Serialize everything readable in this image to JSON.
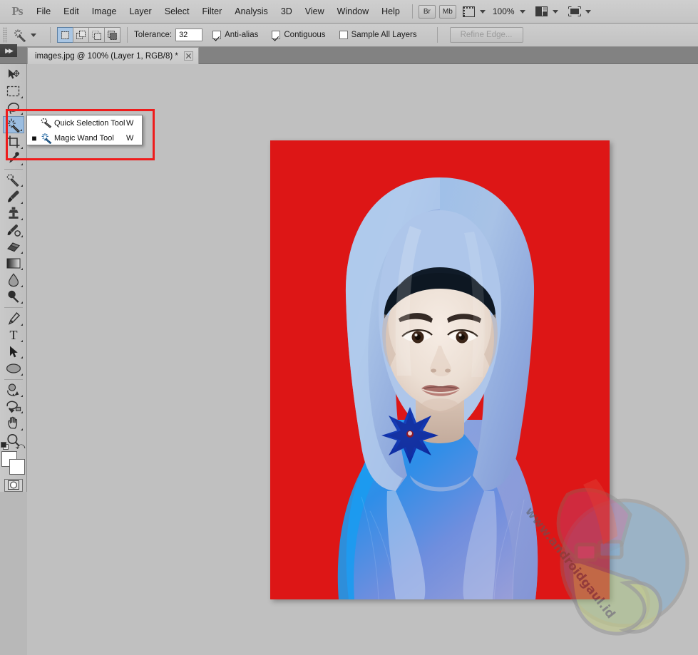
{
  "app": {
    "name": "Adobe Photoshop CS5",
    "logo_text": "Ps"
  },
  "menubar": {
    "items": [
      {
        "label": "File"
      },
      {
        "label": "Edit"
      },
      {
        "label": "Image"
      },
      {
        "label": "Layer"
      },
      {
        "label": "Select"
      },
      {
        "label": "Filter"
      },
      {
        "label": "Analysis"
      },
      {
        "label": "3D"
      },
      {
        "label": "View"
      },
      {
        "label": "Window"
      },
      {
        "label": "Help"
      }
    ],
    "bridge_label": "Br",
    "minibridge_label": "Mb",
    "zoom_level": "100%",
    "view_extras_icon": "view-extras-icon",
    "arrange_documents_icon": "arrange-documents-icon",
    "screen_mode_icon": "screen-mode-icon"
  },
  "optionsbar": {
    "tool_icon": "magic-wand-icon",
    "tool_preset_caret": "chevron-down-icon",
    "selection_modes": [
      {
        "name": "new-selection",
        "active": true
      },
      {
        "name": "add-to-selection",
        "active": false
      },
      {
        "name": "subtract-from-selection",
        "active": false
      },
      {
        "name": "intersect-with-selection",
        "active": false
      }
    ],
    "tolerance_label": "Tolerance:",
    "tolerance_value": "32",
    "checkboxes": [
      {
        "label": "Anti-alias",
        "checked": true
      },
      {
        "label": "Contiguous",
        "checked": true
      },
      {
        "label": "Sample All Layers",
        "checked": false
      }
    ],
    "refine_edge_label": "Refine Edge...",
    "refine_edge_disabled": true
  },
  "document": {
    "tab_title": "images.jpg @ 100% (Layer 1, RGB/8) *",
    "close_icon": "close-icon"
  },
  "toolbar": {
    "tools": [
      {
        "name": "move-tool",
        "glyph": "move",
        "selected": false,
        "hasMore": false
      },
      {
        "name": "rectangular-marquee-tool",
        "glyph": "marquee",
        "selected": false,
        "hasMore": true
      },
      {
        "name": "lasso-tool",
        "glyph": "lasso",
        "selected": false,
        "hasMore": true
      },
      {
        "name": "quick-selection-tool",
        "glyph": "wand",
        "selected": true,
        "hasMore": true
      },
      {
        "name": "crop-tool",
        "glyph": "crop",
        "selected": false,
        "hasMore": true
      },
      {
        "name": "eyedropper-tool",
        "glyph": "eyedropper",
        "selected": false,
        "hasMore": true
      },
      {
        "name": "spot-healing-brush-tool",
        "glyph": "heal",
        "selected": false,
        "hasMore": true
      },
      {
        "name": "brush-tool",
        "glyph": "brush",
        "selected": false,
        "hasMore": true
      },
      {
        "name": "clone-stamp-tool",
        "glyph": "stamp",
        "selected": false,
        "hasMore": true
      },
      {
        "name": "history-brush-tool",
        "glyph": "historybrush",
        "selected": false,
        "hasMore": true
      },
      {
        "name": "eraser-tool",
        "glyph": "eraser",
        "selected": false,
        "hasMore": true
      },
      {
        "name": "gradient-tool",
        "glyph": "gradient",
        "selected": false,
        "hasMore": true
      },
      {
        "name": "blur-tool",
        "glyph": "blur",
        "selected": false,
        "hasMore": true
      },
      {
        "name": "dodge-tool",
        "glyph": "dodge",
        "selected": false,
        "hasMore": true
      },
      {
        "name": "pen-tool",
        "glyph": "pen",
        "selected": false,
        "hasMore": true
      },
      {
        "name": "horizontal-type-tool",
        "glyph": "type",
        "selected": false,
        "hasMore": true
      },
      {
        "name": "path-selection-tool",
        "glyph": "pathselect",
        "selected": false,
        "hasMore": true
      },
      {
        "name": "ellipse-tool",
        "glyph": "ellipse",
        "selected": false,
        "hasMore": true
      },
      {
        "name": "3d-object-rotate-tool",
        "glyph": "rotate3d",
        "selected": false,
        "hasMore": true
      },
      {
        "name": "3d-camera-rotate-tool",
        "glyph": "camera3d",
        "selected": false,
        "hasMore": true
      },
      {
        "name": "hand-tool",
        "glyph": "hand",
        "selected": false,
        "hasMore": true
      },
      {
        "name": "zoom-tool",
        "glyph": "zoom",
        "selected": false,
        "hasMore": false
      }
    ],
    "foreground_color": "#ffffff",
    "background_color": "#ffffff",
    "swap-colors-icon": "swap-colors-icon",
    "default-colors-icon": "default-colors-icon",
    "quick-mask-icon": "quick-mask-icon"
  },
  "flyout": {
    "items": [
      {
        "label": "Quick Selection Tool",
        "shortcut": "W",
        "active": false,
        "icon": "quick-selection-icon"
      },
      {
        "label": "Magic Wand Tool",
        "shortcut": "W",
        "active": true,
        "icon": "magic-wand-icon"
      }
    ],
    "highlight_color": "#ee1c1c"
  },
  "canvas": {
    "background_color": "#dd1616",
    "photo_name": "portrait-photo",
    "watermark_text": "www.androidgaul.id",
    "watermark_logo": "androidgaul-logo-icon"
  }
}
